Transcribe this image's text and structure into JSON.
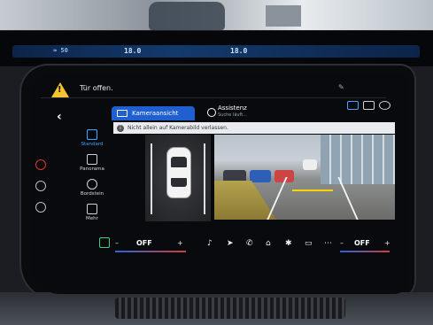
{
  "cluster": {
    "readouts": [
      "≈ 50",
      "18.0",
      "18.0"
    ]
  },
  "alert": {
    "text": "Tür offen."
  },
  "tabs": {
    "camera_label": "Kameraansicht",
    "assist_label": "Assistenz",
    "assist_sub": "Suche läuft..."
  },
  "info": {
    "text": "Nicht allein auf Kamerabild verlassen."
  },
  "views": [
    {
      "label": "Standard",
      "active": true
    },
    {
      "label": "Panorama",
      "active": false
    },
    {
      "label": "Bordstein",
      "active": false
    },
    {
      "label": "Mehr",
      "active": false
    }
  ],
  "climate": {
    "left_temp": "OFF",
    "right_temp": "OFF",
    "minus": "–",
    "plus": "+"
  },
  "colors": {
    "accent": "#1f5fd0",
    "active_view": "#3fa8ff",
    "warning": "#f4c430",
    "seat": "#3fd07a"
  }
}
